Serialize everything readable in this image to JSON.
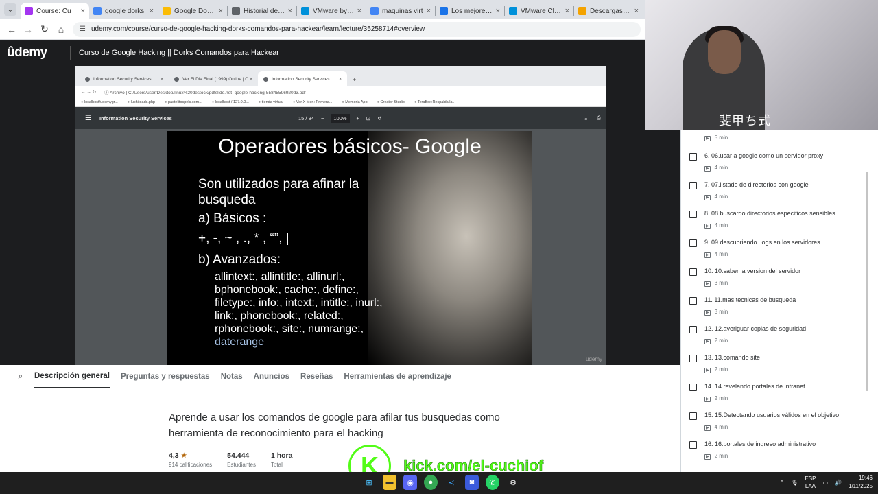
{
  "browser": {
    "tabs": [
      {
        "title": "Course: Cu",
        "active": true,
        "favicon_color": "#a435f0"
      },
      {
        "title": "google dorks",
        "favicon_color": "#4285f4"
      },
      {
        "title": "Google Dorks",
        "favicon_color": "#fbbc05"
      },
      {
        "title": "Historial de de",
        "favicon_color": "#5f6368"
      },
      {
        "title": "VMware by Bro",
        "favicon_color": "#0091da"
      },
      {
        "title": "maquinas virt",
        "favicon_color": "#4285f4"
      },
      {
        "title": "Los mejores p",
        "favicon_color": "#1a73e8"
      },
      {
        "title": "VMware Cloud",
        "favicon_color": "#0091da"
      },
      {
        "title": "Descargas – O",
        "favicon_color": "#f4a300"
      }
    ],
    "url": "udemy.com/course/curso-de-google-hacking-dorks-comandos-para-hackear/learn/lecture/35258714#overview"
  },
  "header": {
    "logo": "ûdemy",
    "course_title": "Curso de Google Hacking || Dorks Comandos para Hackear"
  },
  "inner_browser": {
    "tabs": [
      "Information Security Services",
      "Ver El Dia Final (1999) Online | C",
      "Information Security Services"
    ],
    "url_prefix": "Archivo",
    "url": "C:/Users/user/Desktop/linux%20destock/pdfslide.net_google-hacking-55845596920d3.pdf",
    "bookmarks": [
      "localhost/udemygr...",
      "luchitoads.php",
      "pastelitospels.com...",
      "localhost / 127.0.0...",
      "tienda virtual",
      "Ver X Men: Primera...",
      "Memoria App",
      "Creator Studio",
      "TeraBox:Respalda la..."
    ],
    "pdf_title": "Information Security Services",
    "page": "15",
    "total_pages": "84",
    "zoom": "100%"
  },
  "slide": {
    "title": "Operadores básicos- Google",
    "line1": "Son utilizados para afinar la",
    "line2": "busqueda",
    "line3": "a) Básicos :",
    "line4": "+, -, ~ , ., * , “”, |",
    "line5": "b) Avanzados:",
    "adv1": "allintext:, allintitle:, allinurl:,",
    "adv2": "bphonebook:, cache:, define:,",
    "adv3": "filetype:, info:, intext:, intitle:, inurl:,",
    "adv4": "link:, phonebook:, related:,",
    "adv5": "rphonebook:, site:, numrange:,",
    "adv6": "daterange",
    "watermark": "ûdemy"
  },
  "course_tabs": [
    "Descripción general",
    "Preguntas y respuestas",
    "Notas",
    "Anuncios",
    "Reseñas",
    "Herramientas de aprendizaje"
  ],
  "overview": {
    "text": "Aprende a usar los comandos de google para afilar tus busquedas como herramienta de reconocimiento para el hacking",
    "rating": "4,3",
    "rating_label": "914 calificaciones",
    "students": "54.444",
    "students_label": "Estudiantes",
    "total": "1 hora",
    "total_label": "Total"
  },
  "kick": {
    "letter": "K",
    "text": "kick.com/el-cuchiof"
  },
  "webcam": {
    "shirt_text": "斐甲ち式"
  },
  "sidebar": {
    "lectures": [
      {
        "name": "",
        "duration": "5 min"
      },
      {
        "name": "6. 06.usar a google como un servidor proxy",
        "duration": "4 min"
      },
      {
        "name": "7. 07.listado de directorios con google",
        "duration": "4 min"
      },
      {
        "name": "8. 08.buscardo directorios especificos sensibles",
        "duration": "4 min"
      },
      {
        "name": "9. 09.descubriendo .logs en los servidores",
        "duration": "4 min"
      },
      {
        "name": "10. 10.saber la version del servidor",
        "duration": "3 min"
      },
      {
        "name": "11. 11.mas tecnicas de busqueda",
        "duration": "3 min"
      },
      {
        "name": "12. 12.averiguar copias de seguridad",
        "duration": "2 min"
      },
      {
        "name": "13. 13.comando site",
        "duration": "2 min"
      },
      {
        "name": "14. 14.revelando portales de intranet",
        "duration": "2 min"
      },
      {
        "name": "15. 15.Detectando usuarios válidos en el objetivo",
        "duration": "4 min"
      },
      {
        "name": "16. 16.portales de ingreso administrativo",
        "duration": "2 min"
      }
    ]
  },
  "taskbar": {
    "lang1": "ESP",
    "lang2": "LAA",
    "time": "19:46",
    "date": "1/11/2025"
  }
}
